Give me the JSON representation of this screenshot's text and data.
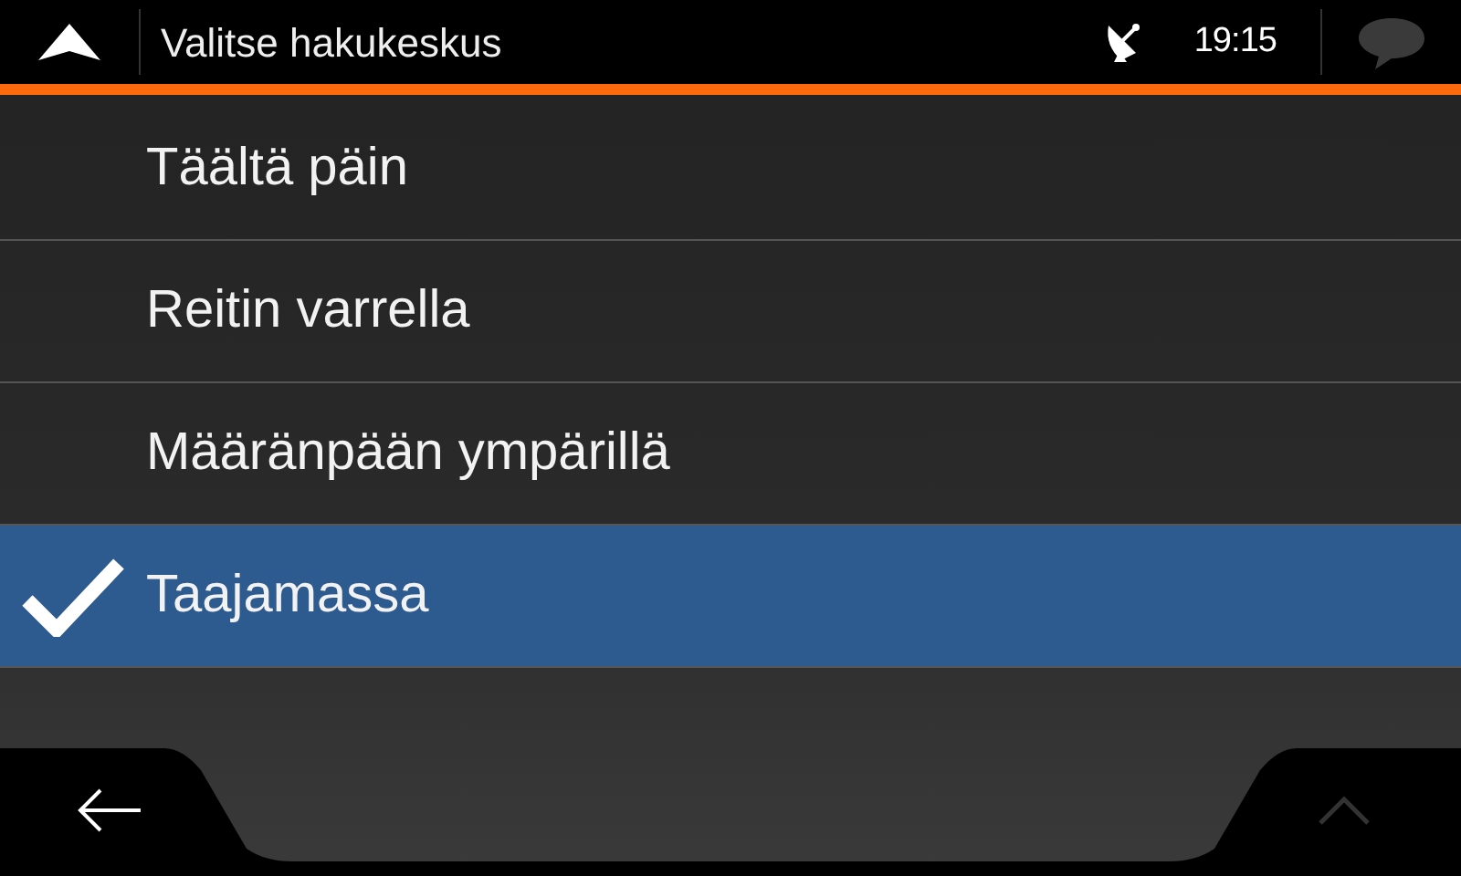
{
  "header": {
    "title": "Valitse hakukeskus",
    "time": "19:15",
    "messages_enabled": false
  },
  "options": [
    {
      "label": "Täältä päin",
      "selected": false
    },
    {
      "label": "Reitin varrella",
      "selected": false
    },
    {
      "label": "Määränpään ympärillä",
      "selected": false
    },
    {
      "label": "Taajamassa",
      "selected": true
    }
  ],
  "footer": {
    "up_disabled": true
  }
}
